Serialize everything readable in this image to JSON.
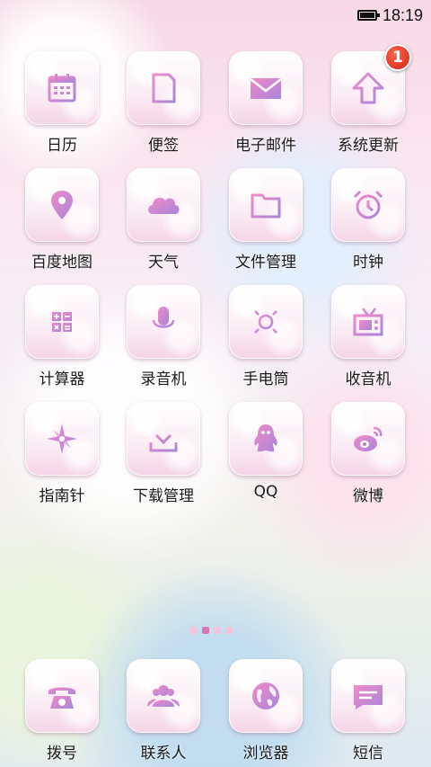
{
  "status_bar": {
    "time": "18:19",
    "battery_icon": "battery-full-icon"
  },
  "theme": {
    "accent": "#d86fb0",
    "icon_gradient": [
      "#f08ac8",
      "#a985d9"
    ]
  },
  "apps": [
    {
      "label": "日历",
      "icon": "calendar-icon"
    },
    {
      "label": "便签",
      "icon": "notes-icon"
    },
    {
      "label": "电子邮件",
      "icon": "mail-icon"
    },
    {
      "label": "系统更新",
      "icon": "update-arrow-icon",
      "badge": "1"
    },
    {
      "label": "百度地图",
      "icon": "map-pin-icon"
    },
    {
      "label": "天气",
      "icon": "cloud-icon"
    },
    {
      "label": "文件管理",
      "icon": "folder-icon"
    },
    {
      "label": "时钟",
      "icon": "alarm-clock-icon"
    },
    {
      "label": "计算器",
      "icon": "calculator-icon"
    },
    {
      "label": "录音机",
      "icon": "microphone-icon"
    },
    {
      "label": "手电筒",
      "icon": "sun-icon"
    },
    {
      "label": "收音机",
      "icon": "radio-icon"
    },
    {
      "label": "指南针",
      "icon": "compass-icon"
    },
    {
      "label": "下载管理",
      "icon": "download-icon"
    },
    {
      "label": "QQ",
      "icon": "qq-penguin-icon"
    },
    {
      "label": "微博",
      "icon": "weibo-icon"
    }
  ],
  "pager": {
    "page_count": 4,
    "current_page": 2
  },
  "dock": [
    {
      "label": "拨号",
      "icon": "phone-icon"
    },
    {
      "label": "联系人",
      "icon": "contacts-icon"
    },
    {
      "label": "浏览器",
      "icon": "globe-icon"
    },
    {
      "label": "短信",
      "icon": "message-icon"
    }
  ]
}
